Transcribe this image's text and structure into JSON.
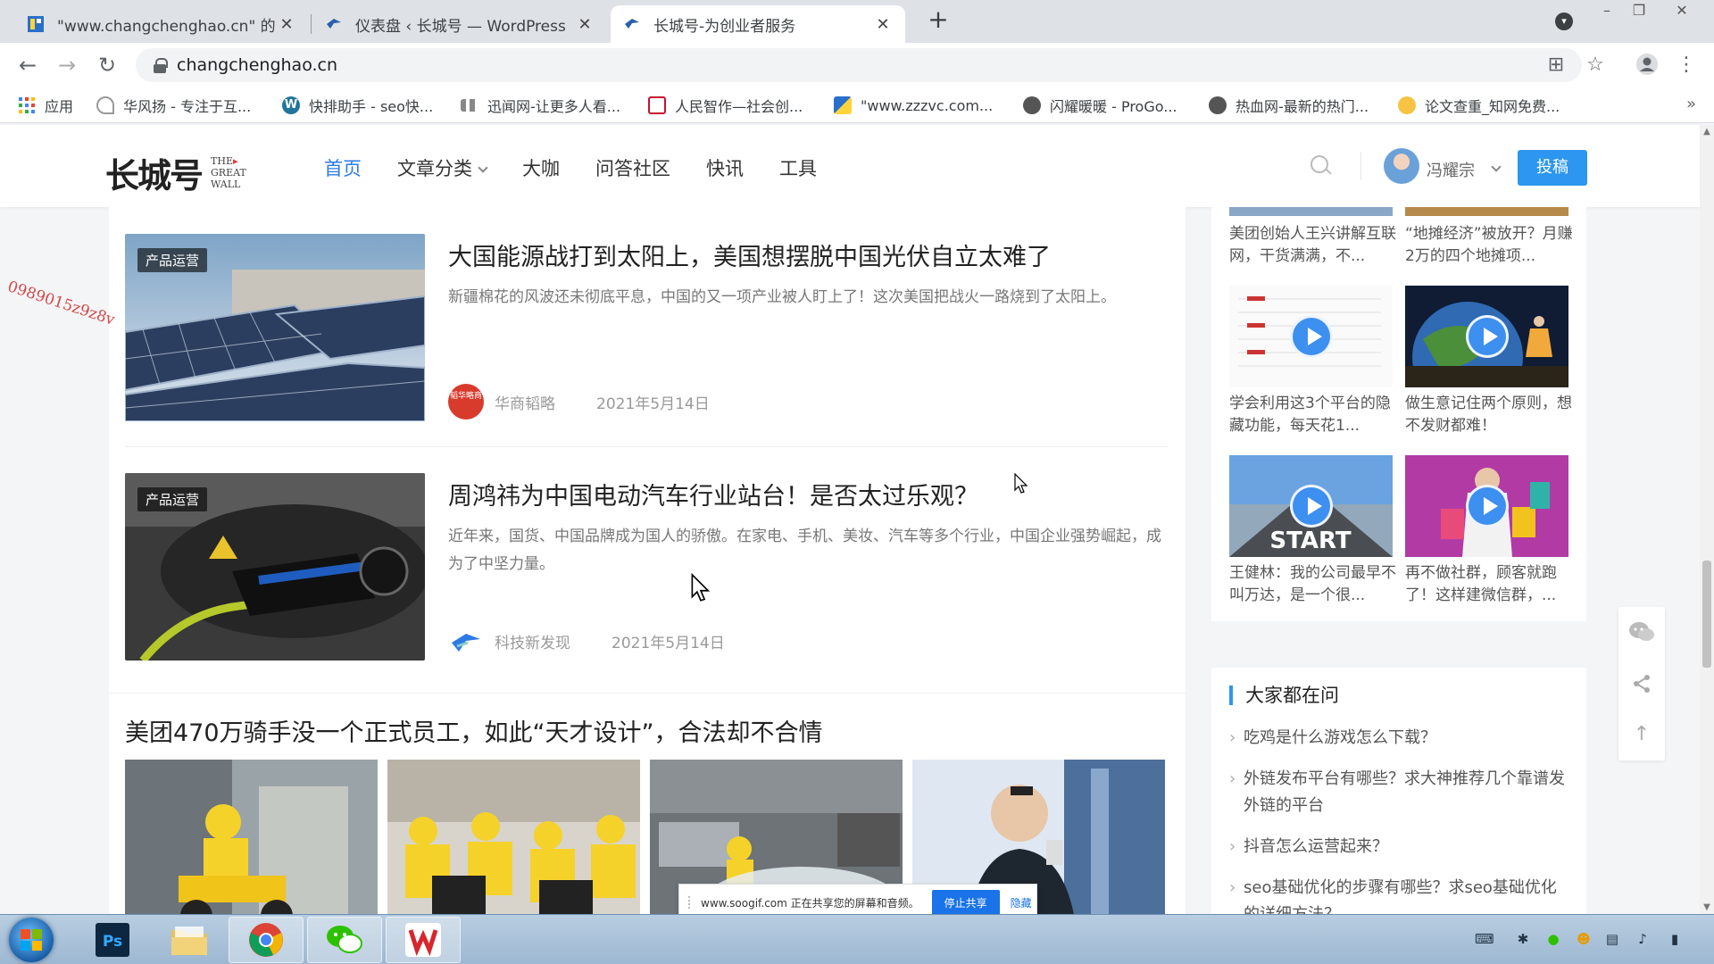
{
  "browser": {
    "tabs": [
      {
        "title": "\"www.changchenghao.cn\" 的"
      },
      {
        "title": "仪表盘 ‹ 长城号 — WordPress"
      },
      {
        "title": "长城号-为创业者服务"
      }
    ],
    "url": "changchenghao.cn",
    "bookmarks": [
      "应用",
      "华风扬 - 专注于互...",
      "快排助手 - seo快...",
      "迅闻网-让更多人看...",
      "人民智作—社会创...",
      "\"www.zzzvc.com...",
      "闪耀暖暖 - ProGo...",
      "热血网-最新的热门...",
      "论文查重_知网免费..."
    ],
    "more": "»"
  },
  "site": {
    "logo_cn": "长城号",
    "logo_en": [
      "THE",
      "GREAT",
      "WALL"
    ],
    "nav": [
      "首页",
      "文章分类",
      "大咖",
      "问答社区",
      "快讯",
      "工具"
    ],
    "user": "冯耀宗",
    "submit": "投稿"
  },
  "articles": [
    {
      "tag": "产品运营",
      "title": "大国能源战打到太阳上，美国想摆脱中国光伏自立太难了",
      "excerpt": "新疆棉花的风波还未彻底平息，中国的又一项产业被人盯上了！这次美国把战火一路烧到了太阳上。",
      "author": "华商韬略",
      "author_badge": "韬华略商",
      "date": "2021年5月14日"
    },
    {
      "tag": "产品运营",
      "title": "周鸿祎为中国电动汽车行业站台！是否太过乐观？",
      "excerpt": "近年来，国货、中国品牌成为国人的骄傲。在家电、手机、美妆、汽车等多个行业，中国企业强势崛起，成为了中坚力量。",
      "author": "科技新发现",
      "date": "2021年5月14日"
    }
  ],
  "gallery_article": {
    "title": "美团470万骑手没一个正式员工，如此“天才设计”，合法却不合情"
  },
  "sidebar": {
    "top_videos": [
      "美团创始人王兴讲解互联网，干货满满，不...",
      "“地摊经济”被放开？月赚2万的四个地摊项..."
    ],
    "videos": [
      {
        "title": "学会利用这3个平台的隐藏功能，每天花1..."
      },
      {
        "title": "做生意记住两个原则，想不发财都难！"
      },
      {
        "title": "王健林：我的公司最早不叫万达，是一个很..."
      },
      {
        "title": "再不做社群，顾客就跑了！这样建微信群，..."
      }
    ],
    "start_label": "START",
    "qa_title": "大家都在问",
    "qa": [
      "吃鸡是什么游戏怎么下载？",
      "外链发布平台有哪些？求大神推荐几个靠谱发外链的平台",
      "抖音怎么运营起来？",
      "seo基础优化的步骤有哪些？求seo基础优化的详细方法？"
    ]
  },
  "watermark": "0989015z9z8v",
  "share_notice": {
    "text": "www.soogif.com 正在共享您的屏幕和音频。",
    "stop": "停止共享",
    "hide": "隐藏"
  },
  "colors": {
    "accent": "#2c96f0",
    "nav_active": "#2c7be5",
    "watermark": "#d34a4a"
  }
}
